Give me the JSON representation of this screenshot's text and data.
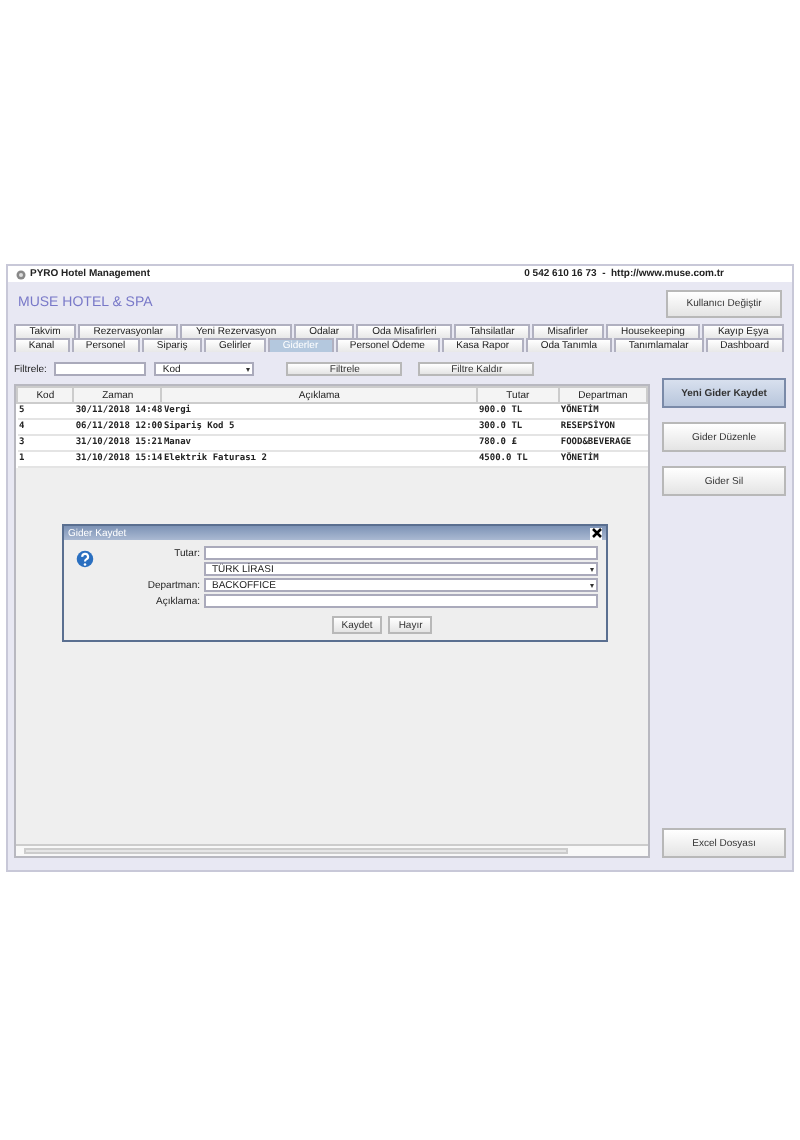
{
  "window": {
    "title": "PYRO Hotel Management",
    "contact": "0 542 610 16 73  -  http://www.muse.com.tr"
  },
  "header": {
    "brand": "MUSE HOTEL & SPA",
    "user_button": "Kullanıcı Değiştir"
  },
  "tabs": [
    [
      {
        "label": "Takvim",
        "selected": false
      },
      {
        "label": "Rezervasyonlar",
        "selected": false
      },
      {
        "label": "Yeni Rezervasyon",
        "selected": false
      },
      {
        "label": "Odalar",
        "selected": false
      },
      {
        "label": "Oda Misafirleri",
        "selected": false
      },
      {
        "label": "Tahsilatlar",
        "selected": false
      },
      {
        "label": "Misafirler",
        "selected": false
      },
      {
        "label": "Housekeeping",
        "selected": false
      },
      {
        "label": "Kayıp Eşya",
        "selected": false
      }
    ],
    [
      {
        "label": "Kanal",
        "selected": false
      },
      {
        "label": "Personel",
        "selected": false
      },
      {
        "label": "Sipariş",
        "selected": false
      },
      {
        "label": "Gelirler",
        "selected": false
      },
      {
        "label": "Giderler",
        "selected": true
      },
      {
        "label": "Personel Ödeme",
        "selected": false
      },
      {
        "label": "Kasa Rapor",
        "selected": false
      },
      {
        "label": "Oda Tanımla",
        "selected": false
      },
      {
        "label": "Tanımlamalar",
        "selected": false
      },
      {
        "label": "Dashboard",
        "selected": false
      }
    ]
  ],
  "filter": {
    "label": "Filtrele:",
    "field_combo": "Kod",
    "filter_button": "Filtrele",
    "clear_button": "Filtre Kaldır"
  },
  "table": {
    "columns": [
      "Kod",
      "Zaman",
      "Açıklama",
      "Tutar",
      "Departman"
    ],
    "rows": [
      [
        "5",
        "30/11/2018 14:48",
        "Vergi",
        "900.0 TL",
        "YÖNETİM"
      ],
      [
        "4",
        "06/11/2018 12:00",
        "Sipariş Kod 5",
        "300.0 TL",
        "RESEPSİYON"
      ],
      [
        "3",
        "31/10/2018 15:21",
        "Manav",
        "780.0 £",
        "FOOD&BEVERAGE"
      ],
      [
        "1",
        "31/10/2018 15:14",
        "Elektrik Faturası 2",
        "4500.0 TL",
        "YÖNETİM"
      ]
    ]
  },
  "side_buttons": [
    {
      "label": "Yeni Gider Kaydet",
      "selected": true
    },
    {
      "label": "Gider Düzenle",
      "selected": false
    },
    {
      "label": "Gider Sil",
      "selected": false
    }
  ],
  "export_button": "Excel Dosyası",
  "dialog": {
    "title": "Gider Kaydet",
    "fields": [
      {
        "kind": "text",
        "label": "Tutar:"
      },
      {
        "kind": "combo",
        "value": "TÜRK LİRASI"
      },
      {
        "kind": "combo",
        "label": "Departman:",
        "value": "BACKOFFICE"
      },
      {
        "kind": "text",
        "label": "Açıklama:"
      }
    ],
    "buttons": [
      "Kaydet",
      "Hayır"
    ]
  }
}
